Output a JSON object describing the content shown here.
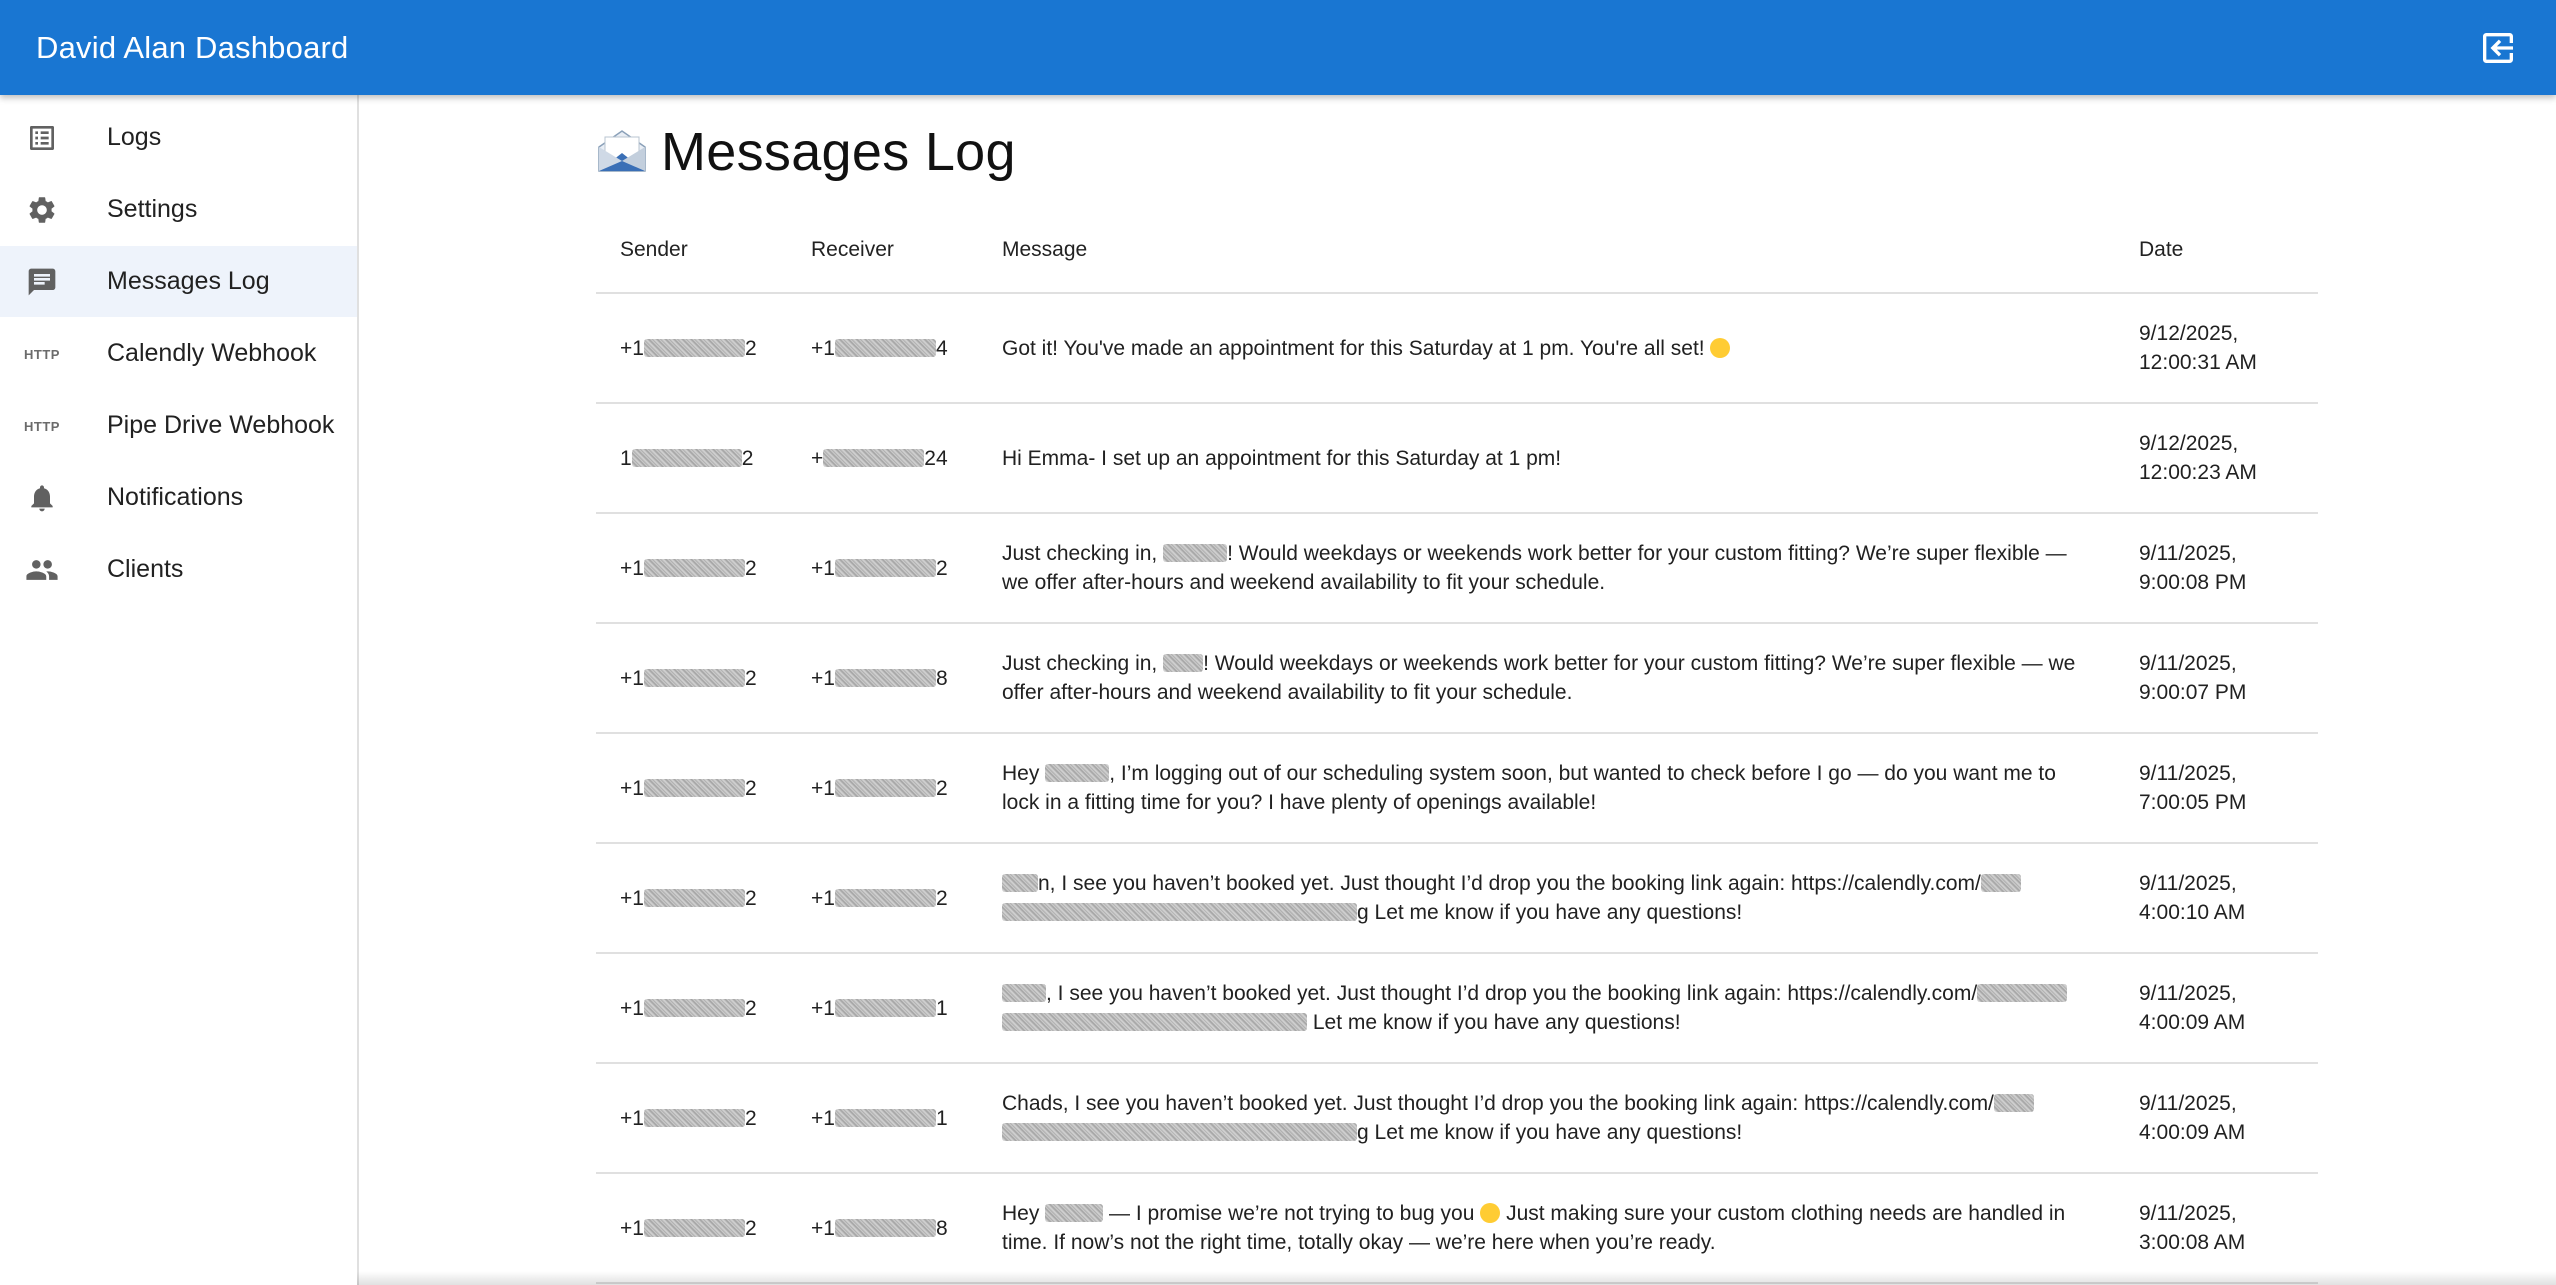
{
  "app": {
    "title": "David Alan Dashboard",
    "logout_icon": "logout-icon"
  },
  "sidebar": {
    "items": [
      {
        "label": "Logs",
        "icon": "list-icon"
      },
      {
        "label": "Settings",
        "icon": "gear-icon"
      },
      {
        "label": "Messages Log",
        "icon": "message-icon",
        "active": true
      },
      {
        "label": "Calendly Webhook",
        "icon": "http-icon",
        "icon_text": "HTTP"
      },
      {
        "label": "Pipe Drive Webhook",
        "icon": "http-icon",
        "icon_text": "HTTP"
      },
      {
        "label": "Notifications",
        "icon": "bell-icon"
      },
      {
        "label": "Clients",
        "icon": "people-icon"
      }
    ]
  },
  "page": {
    "title": "Messages Log",
    "title_icon": "envelope-icon"
  },
  "table": {
    "headers": {
      "sender": "Sender",
      "receiver": "Receiver",
      "message": "Message",
      "date": "Date"
    },
    "rows": [
      {
        "sender_a": "+1",
        "sender_b": "2",
        "receiver_a": "+1",
        "receiver_b": "4",
        "message_a": "Got it! You've made an appointment for this Saturday at 1 pm. You're all set!",
        "message_b": "",
        "date_a": "9/12/2025,",
        "date_b": "12:00:31 AM"
      },
      {
        "sender_a": "1",
        "sender_b": "2",
        "receiver_a": "+",
        "receiver_b": "24",
        "message_a": "Hi Emma- I set up an appointment for this Saturday at 1 pm!",
        "message_b": "",
        "date_a": "9/12/2025,",
        "date_b": "12:00:23 AM"
      },
      {
        "sender_a": "+1",
        "sender_b": "2",
        "receiver_a": "+1",
        "receiver_b": "2",
        "message_a": "Just checking in,",
        "message_b": "! Would weekdays or weekends work better for your custom fitting? We’re super flexible — we offer after-hours and weekend availability to fit your schedule.",
        "date_a": "9/11/2025,",
        "date_b": "9:00:08 PM"
      },
      {
        "sender_a": "+1",
        "sender_b": "2",
        "receiver_a": "+1",
        "receiver_b": "8",
        "message_a": "Just checking in,",
        "message_b": "! Would weekdays or weekends work better for your custom fitting? We’re super flexible — we offer after-hours and weekend availability to fit your schedule.",
        "date_a": "9/11/2025,",
        "date_b": "9:00:07 PM"
      },
      {
        "sender_a": "+1",
        "sender_b": "2",
        "receiver_a": "+1",
        "receiver_b": "2",
        "message_a": "Hey",
        "message_b": ", I’m logging out of our scheduling system soon, but wanted to check before I go — do you want me to lock in a fitting time for you? I have plenty of openings available!",
        "date_a": "9/11/2025,",
        "date_b": "7:00:05 PM"
      },
      {
        "sender_a": "+1",
        "sender_b": "2",
        "receiver_a": "+1",
        "receiver_b": "2",
        "message_a": "n, I see you haven’t booked yet. Just thought I’d drop you the booking link again: https://calendly.com/",
        "message_b": "g Let me know if you have any questions!",
        "date_a": "9/11/2025,",
        "date_b": "4:00:10 AM"
      },
      {
        "sender_a": "+1",
        "sender_b": "2",
        "receiver_a": "+1",
        "receiver_b": "1",
        "message_a": ", I see you haven’t booked yet. Just thought I’d drop you the booking link again: https://calendly.com/",
        "message_b": " Let me know if you have any questions!",
        "date_a": "9/11/2025,",
        "date_b": "4:00:09 AM"
      },
      {
        "sender_a": "+1",
        "sender_b": "2",
        "receiver_a": "+1",
        "receiver_b": "1",
        "message_a": "Chads, I see you haven’t booked yet. Just thought I’d drop you the booking link again: https://calendly.com/",
        "message_b": "g Let me know if you have any questions!",
        "date_a": "9/11/2025,",
        "date_b": "4:00:09 AM"
      },
      {
        "sender_a": "+1",
        "sender_b": "2",
        "receiver_a": "+1",
        "receiver_b": "8",
        "message_a": "Hey",
        "message_b": "— I promise we’re not trying to bug you",
        "message_c": "Just making sure your custom clothing needs are handled in time. If now’s not the right time, totally okay — we’re here when you’re ready.",
        "date_a": "9/11/2025,",
        "date_b": "3:00:08 AM"
      }
    ]
  }
}
